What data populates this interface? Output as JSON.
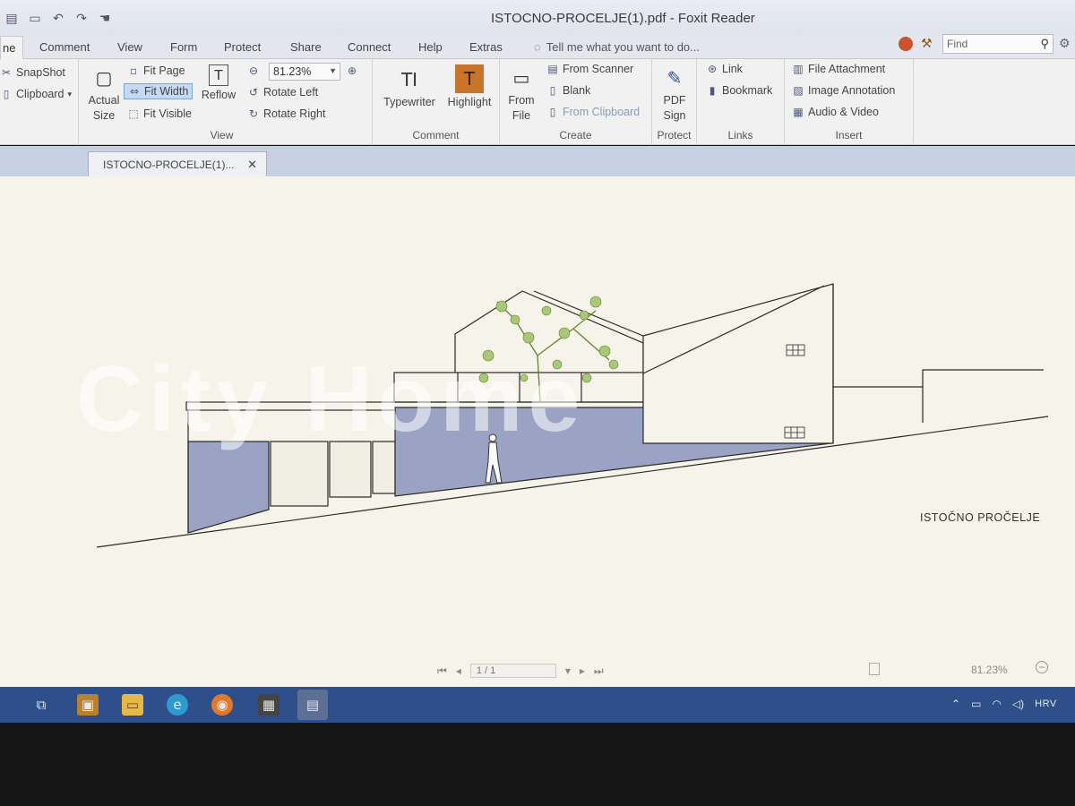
{
  "window": {
    "title": "ISTOCNO-PROCELJE(1).pdf - Foxit Reader"
  },
  "quick_access": [
    "new-file-icon",
    "open-icon",
    "undo-icon",
    "redo-icon",
    "hand-tool-icon"
  ],
  "menu": {
    "tabs": [
      "ne",
      "Comment",
      "View",
      "Form",
      "Protect",
      "Share",
      "Connect",
      "Help",
      "Extras"
    ],
    "tell_me": "Tell me what you want to do...",
    "find_placeholder": "Find"
  },
  "ribbon": {
    "tools": {
      "snapshot": "SnapShot",
      "clipboard": "Clipboard"
    },
    "view": {
      "actual_size": "Actual Size",
      "fit_page": "Fit Page",
      "fit_width": "Fit Width",
      "fit_visible": "Fit Visible",
      "reflow": "Reflow",
      "zoom": "81.23%",
      "rotate_left": "Rotate Left",
      "rotate_right": "Rotate Right",
      "label": "View"
    },
    "comment": {
      "typewriter": "Typewriter",
      "highlight": "Highlight",
      "label": "Comment"
    },
    "create": {
      "from_file": "From File",
      "from_scanner": "From Scanner",
      "blank": "Blank",
      "from_clipboard": "From Clipboard",
      "label": "Create"
    },
    "protect": {
      "pdf_sign": "PDF Sign",
      "label": "Protect"
    },
    "links": {
      "link": "Link",
      "bookmark": "Bookmark",
      "label": "Links"
    },
    "insert": {
      "file_attachment": "File Attachment",
      "image_annotation": "Image Annotation",
      "audio_video": "Audio & Video",
      "label": "Insert"
    }
  },
  "document_tab": {
    "label": "ISTOCNO-PROCELJE(1)..."
  },
  "document": {
    "sheet_title": "ISTOČNO PROČELJE",
    "watermark": "City Home",
    "page_indicator": "1 / 1",
    "status_zoom": "81.23%"
  },
  "taskbar": {
    "apps": [
      "task-view-icon",
      "store-icon",
      "file-explorer-icon",
      "edge-icon",
      "firefox-icon",
      "calculator-icon",
      "foxit-reader-icon"
    ],
    "language": "HRV"
  },
  "colors": {
    "accent": "#2f4f8a",
    "selection": "#c5d9f3",
    "wall_fill": "#9aa3c4"
  }
}
